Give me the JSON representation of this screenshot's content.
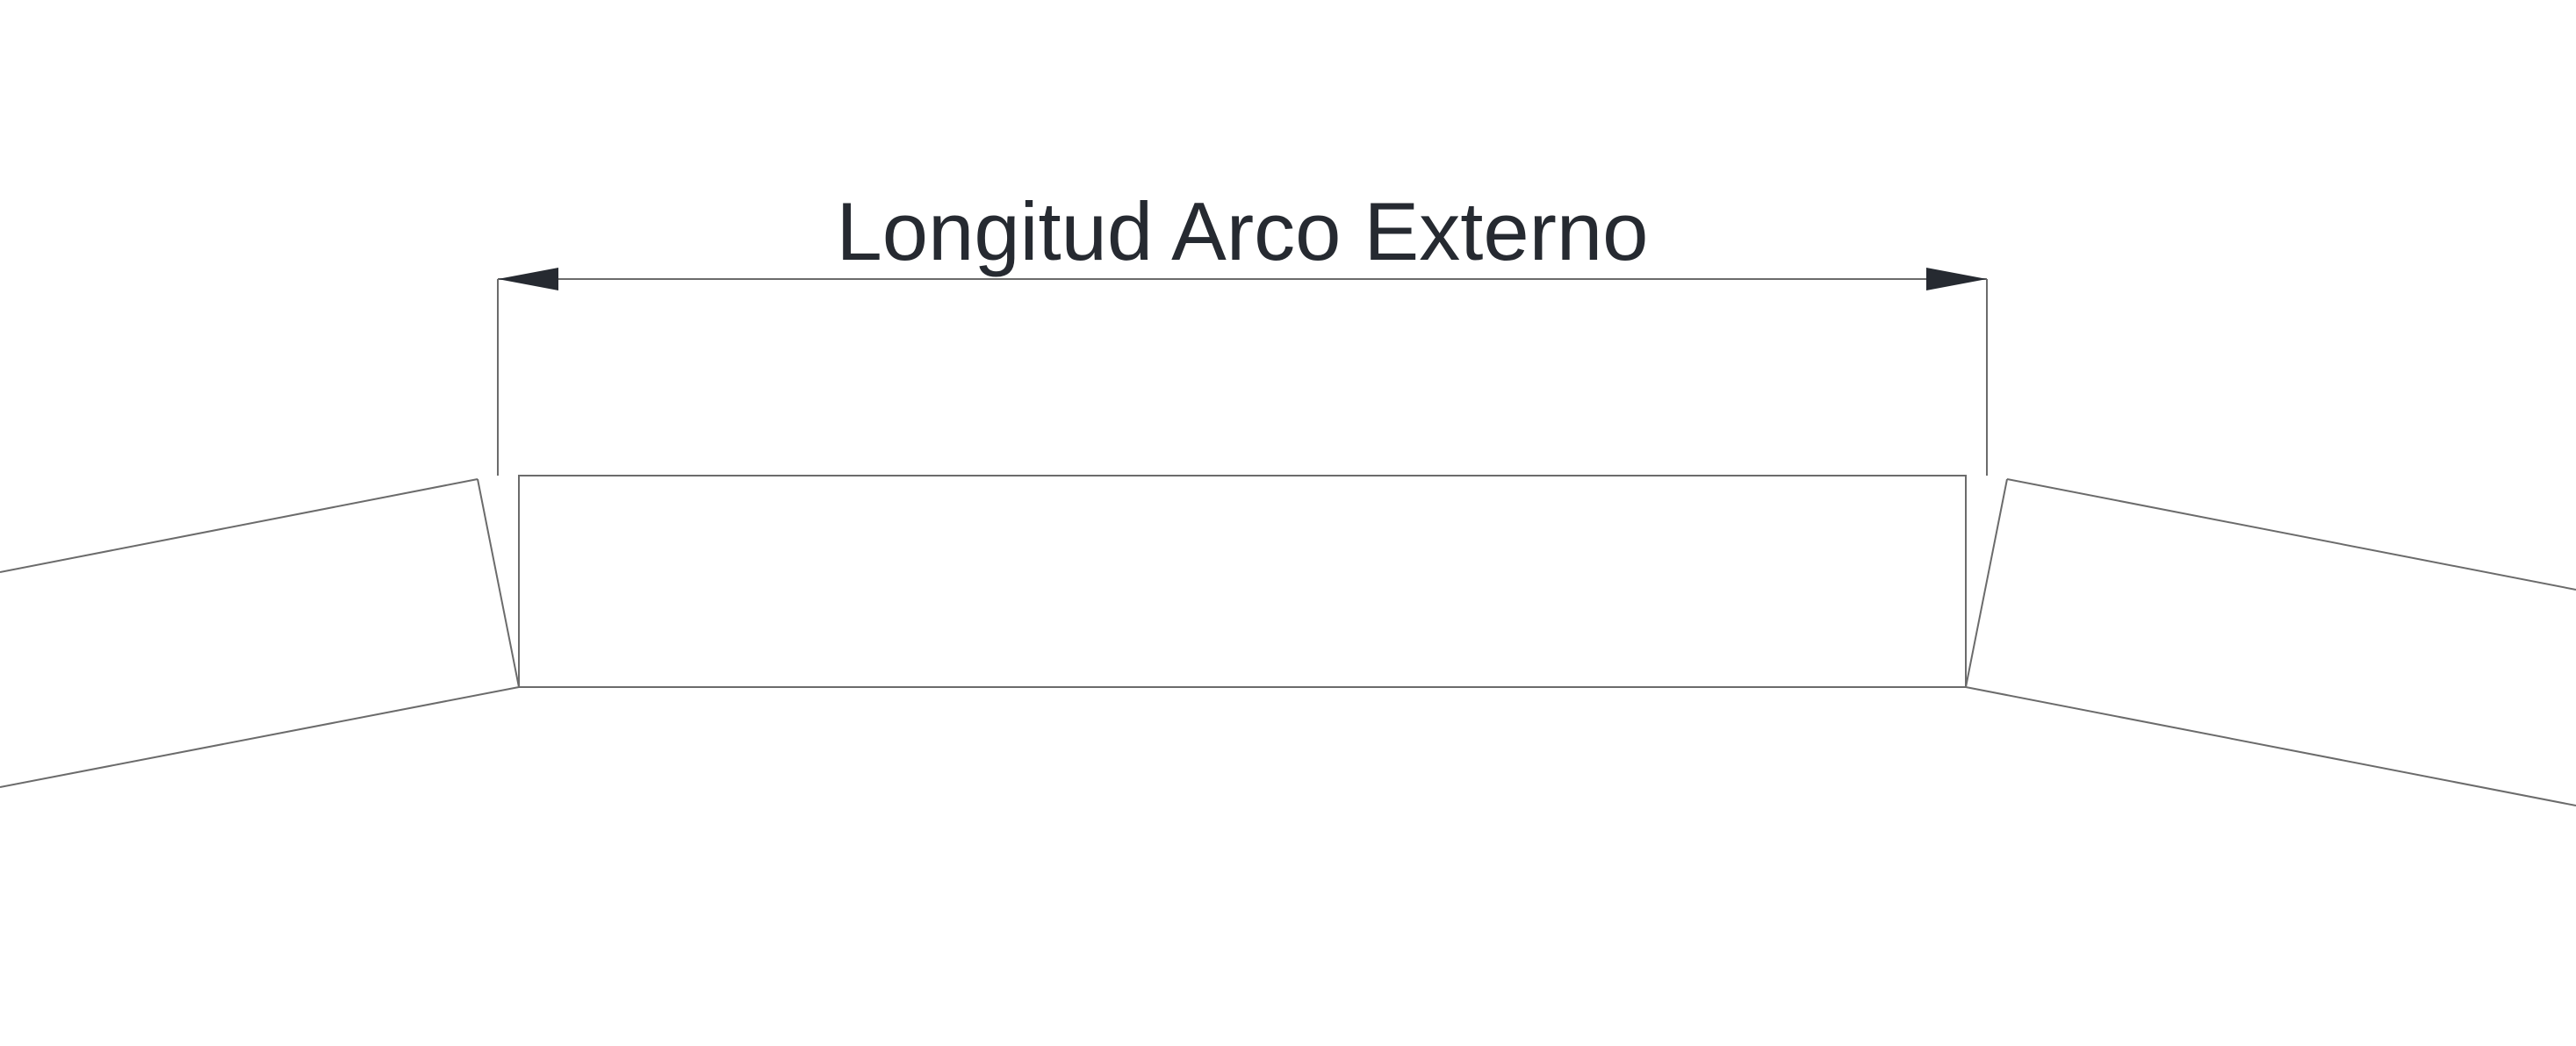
{
  "dimension": {
    "label": "Longitud Arco Externo"
  },
  "colors": {
    "background": "#ffffff",
    "geometry_line": "#6b6b6b",
    "dimension_text": "#262a31",
    "arrowhead": "#262a31"
  }
}
